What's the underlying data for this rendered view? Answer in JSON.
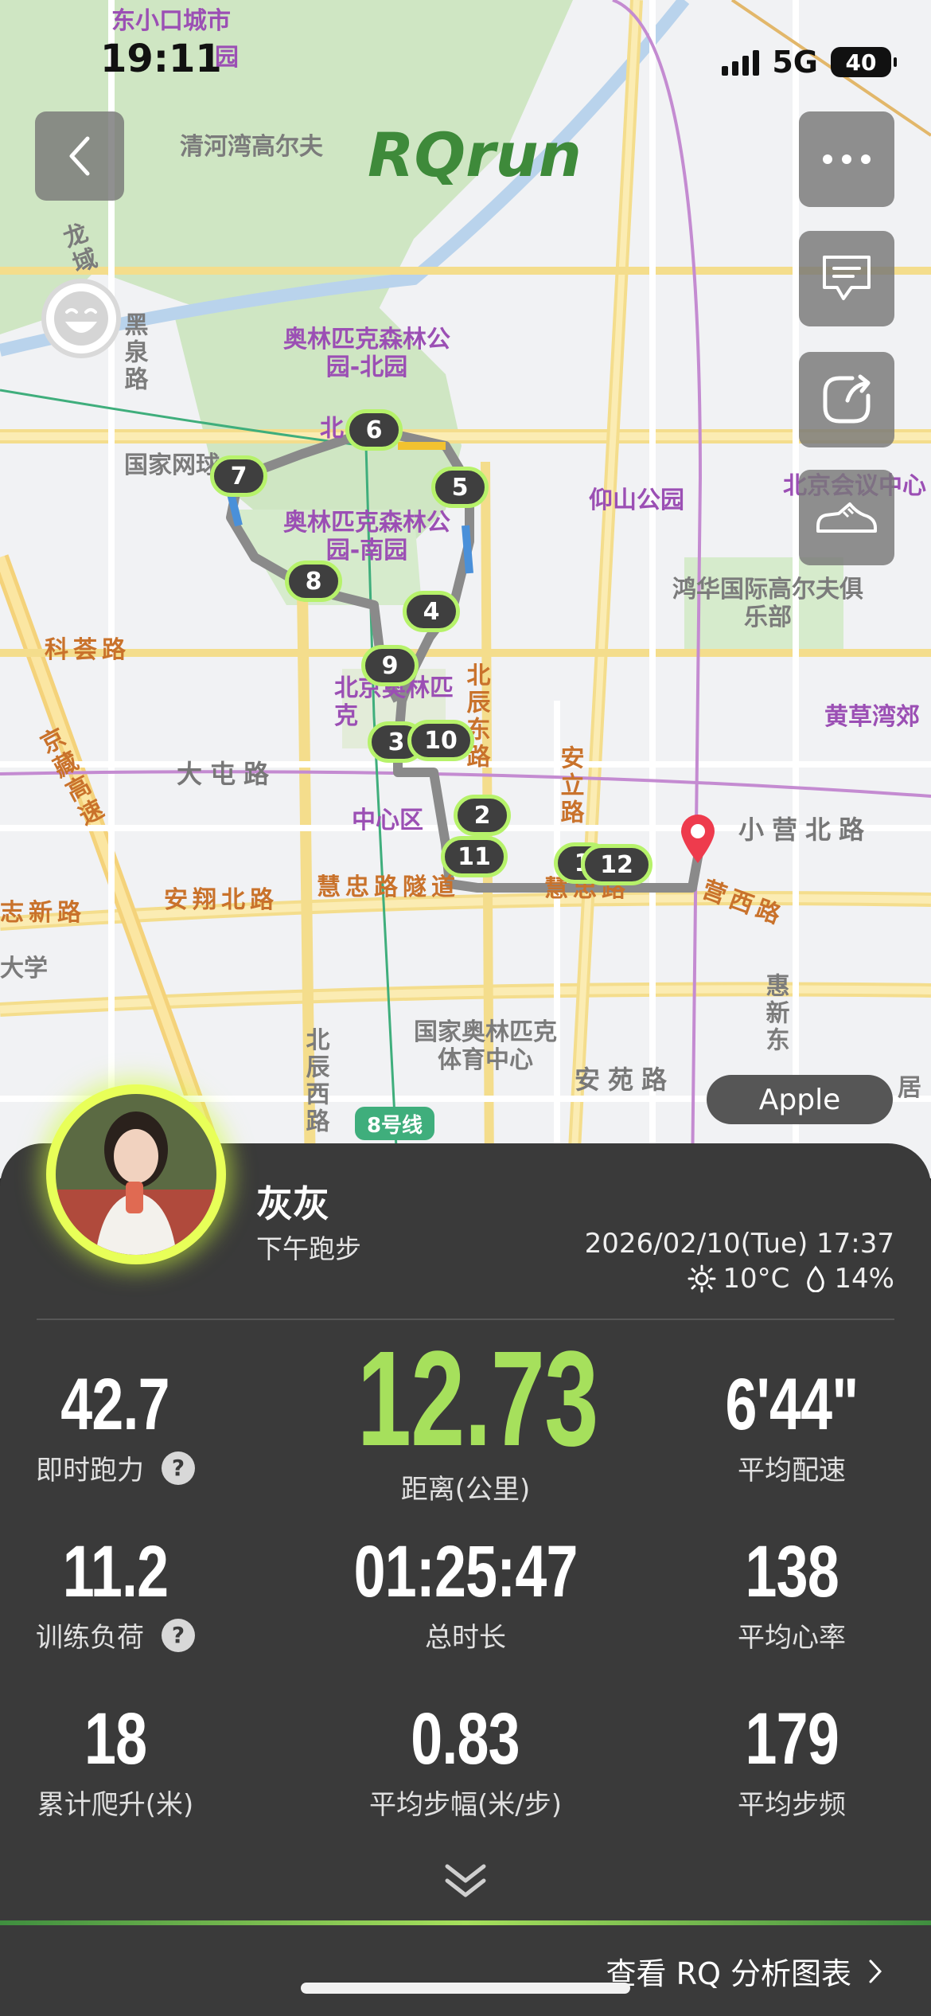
{
  "status_bar": {
    "time": "19:11",
    "network": "5G",
    "battery": "40"
  },
  "brand": "RQrun",
  "map": {
    "labels": {
      "donxiaokou": "东小口城市",
      "donxiaokou2": "园",
      "qinghewan": "清河湾高尔夫",
      "longyu": "龙域",
      "heiquan": "黑泉路",
      "olympic_north": "奥林匹克森林公园-北园",
      "olympic_south": "奥林匹克森林公园-南园",
      "guojiawang": "国家网球",
      "yangshan": "仰山公园",
      "convention": "北京会议中心",
      "honghua": "鸿华国际高尔夫俱乐部",
      "kehui": "科荟路",
      "jingzang": "京藏高速",
      "datun": "大屯路",
      "beijing_olympic": "北京奥林匹克",
      "zhongxin": "中心区",
      "beichen": "北辰东路",
      "anli": "安立路",
      "xiaoying_north": "小营北路",
      "huangcao": "黄草湾郊",
      "zhixin": "志新路",
      "daxue": "大学",
      "anxiang": "安翔北路",
      "huizhong": "慧忠路隧道",
      "huizhong2": "慧忠路",
      "yingxi": "营西路",
      "sports_center": "国家奥林匹克体育中心",
      "anyuan": "安苑路",
      "beichen_west": "北辰西路",
      "huixin": "惠新东",
      "ju": "居",
      "bei": "北",
      "metro": "8号线"
    },
    "markers": [
      "1",
      "2",
      "3",
      "4",
      "5",
      "6",
      "7",
      "8",
      "9",
      "10",
      "11",
      "12"
    ],
    "map_provider": "Apple"
  },
  "buttons": {
    "back_icon": "chevron-left-icon",
    "more_icon": "more-icon",
    "comment_icon": "comment-icon",
    "share_icon": "share-icon",
    "shoe_icon": "shoe-icon"
  },
  "profile": {
    "name": "灰灰",
    "activity": "下午跑步",
    "datetime": "2026/02/10(Tue) 17:37",
    "temperature": "10°C",
    "humidity": "14%"
  },
  "stats": [
    {
      "value": "42.7",
      "label": "即时跑力",
      "help": true
    },
    {
      "value": "12.73",
      "label": "距离(公里)",
      "highlight": true
    },
    {
      "value": "6'44\"",
      "label": "平均配速"
    },
    {
      "value": "11.2",
      "label": "训练负荷",
      "help": true
    },
    {
      "value": "01:25:47",
      "label": "总时长"
    },
    {
      "value": "138",
      "label": "平均心率"
    },
    {
      "value": "18",
      "label": "累计爬升(米)"
    },
    {
      "value": "0.83",
      "label": "平均步幅(米/步)"
    },
    {
      "value": "179",
      "label": "平均步频"
    }
  ],
  "help_mark": "?",
  "analysis_link": "查看 RQ 分析图表",
  "colors": {
    "accent": "#a6e05c",
    "panel": "#3a3a3a",
    "route": "#8a8a8a"
  }
}
